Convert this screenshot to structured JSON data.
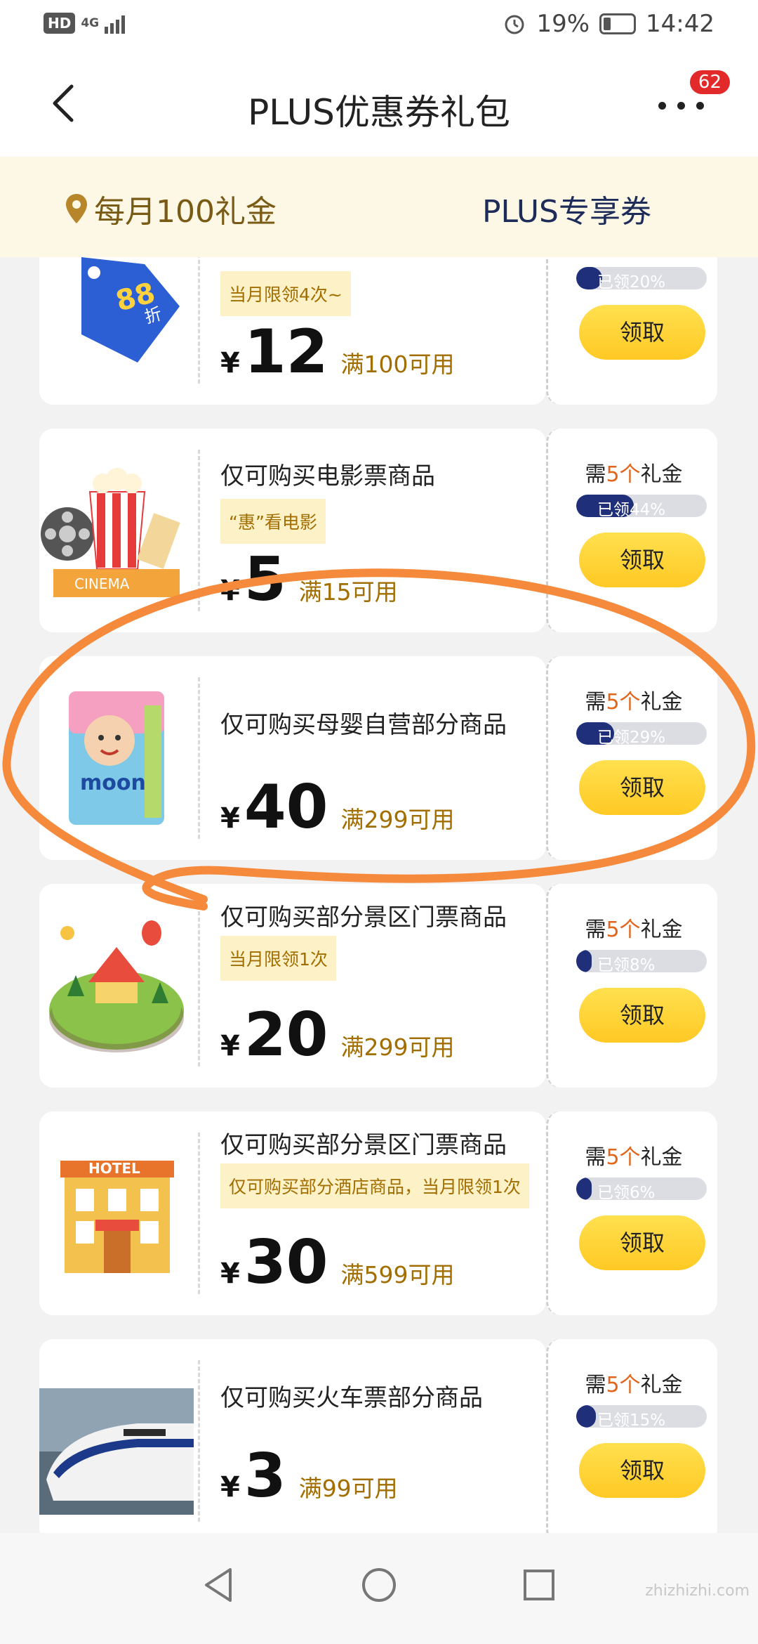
{
  "status_bar": {
    "hd": "HD",
    "network": "4G",
    "battery": "19%",
    "time": "14:42"
  },
  "nav": {
    "title": "PLUS优惠券礼包",
    "badge_count": "62"
  },
  "tabs": {
    "left_label": "每月100礼金",
    "right_label": "PLUS专享券"
  },
  "coupons": [
    {
      "desc": "",
      "tag": "当月限领4次~",
      "yen": "¥",
      "amount": "12",
      "cond": "满100可用",
      "need_prefix": "",
      "need_num": "",
      "need_suffix": "",
      "progress_text": "已领20%",
      "progress": 0.2,
      "button": "领取",
      "icon": "discount-88-tag-icon"
    },
    {
      "desc": "仅可购买电影票商品",
      "tag": "“惠”看电影",
      "yen": "¥",
      "amount": "5",
      "cond": "满15可用",
      "need_prefix": "需",
      "need_num": "5个",
      "need_suffix": "礼金",
      "progress_text": "已领44%",
      "progress": 0.44,
      "button": "领取",
      "icon": "cinema-icon"
    },
    {
      "desc": "仅可购买母婴自营部分商品",
      "tag": "",
      "yen": "¥",
      "amount": "40",
      "cond": "满299可用",
      "need_prefix": "需",
      "need_num": "5个",
      "need_suffix": "礼金",
      "progress_text": "已领29%",
      "progress": 0.29,
      "button": "领取",
      "icon": "diaper-pack-icon"
    },
    {
      "desc": "仅可购买部分景区门票商品",
      "tag": "当月限领1次",
      "yen": "¥",
      "amount": "20",
      "cond": "满299可用",
      "need_prefix": "需",
      "need_num": "5个",
      "need_suffix": "礼金",
      "progress_text": "已领8%",
      "progress": 0.08,
      "button": "领取",
      "icon": "amusement-park-icon"
    },
    {
      "desc": "仅可购买部分景区门票商品",
      "tag": "仅可购买部分酒店商品，当月限领1次",
      "yen": "¥",
      "amount": "30",
      "cond": "满599可用",
      "need_prefix": "需",
      "need_num": "5个",
      "need_suffix": "礼金",
      "progress_text": "已领6%",
      "progress": 0.06,
      "button": "领取",
      "icon": "hotel-icon"
    },
    {
      "desc": "仅可购买火车票部分商品",
      "tag": "",
      "yen": "¥",
      "amount": "3",
      "cond": "满99可用",
      "need_prefix": "需",
      "need_num": "5个",
      "need_suffix": "礼金",
      "progress_text": "已领15%",
      "progress": 0.15,
      "button": "领取",
      "icon": "bullet-train-icon"
    }
  ],
  "watermark": "zhizhizhi.com",
  "colors": {
    "accent_gold": "#ffcc2e",
    "progress_navy": "#1f2f7a",
    "annotation_orange": "#f58a3c"
  }
}
